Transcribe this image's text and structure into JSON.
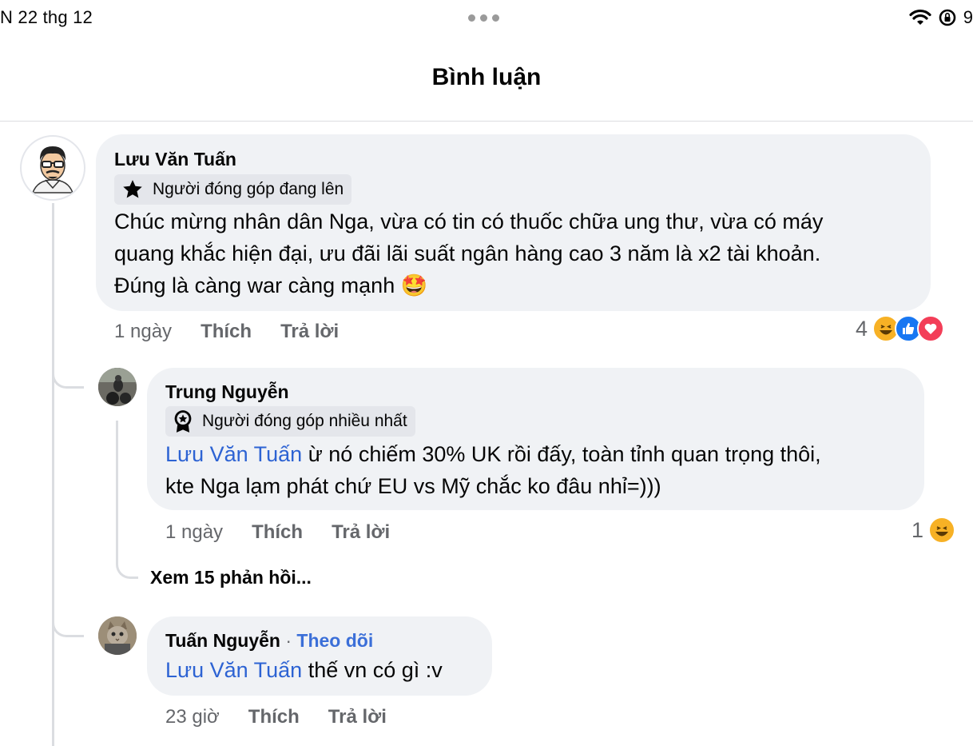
{
  "status_bar": {
    "time": "N 22 thg 12",
    "battery": "9"
  },
  "header": {
    "title": "Bình luận"
  },
  "comments": [
    {
      "author": "Lưu Văn Tuấn",
      "badge": "Người đóng góp đang lên",
      "text_lines": [
        "Chúc mừng nhân dân Nga, vừa có tin có thuốc chữa ung thư, vừa có máy",
        "quang khắc hiện đại, ưu đãi lãi suất ngân hàng cao 3 năm là x2 tài khoản.",
        "Đúng là càng war càng mạnh"
      ],
      "emoji": "🤩",
      "time": "1 ngày",
      "like": "Thích",
      "reply": "Trả lời",
      "reaction_count": "4"
    },
    {
      "author": "Trung Nguyễn",
      "badge": "Người đóng góp nhiều nhất",
      "mention": "Lưu Văn Tuấn",
      "text_first": " ừ nó chiếm 30% UK rồi đấy, toàn tỉnh quan trọng thôi,",
      "text_second": "kte Nga lạm phát chứ EU vs Mỹ chắc ko đâu nhỉ=)))",
      "time": "1 ngày",
      "like": "Thích",
      "reply": "Trả lời",
      "reaction_count": "1",
      "see_more": "Xem 15 phản hồi..."
    },
    {
      "author": "Tuấn Nguyễn",
      "separator": "·",
      "follow": "Theo dõi",
      "mention": "Lưu Văn Tuấn",
      "text": " thế vn có gì :v",
      "time": "23 giờ",
      "like": "Thích",
      "reply": "Trả lời"
    }
  ],
  "colors": {
    "mention": "#2d63d3",
    "bubble": "#f0f2f5",
    "like_blue": "#1877f2",
    "love_red": "#f33e58",
    "haha_yellow": "#f7b125"
  }
}
